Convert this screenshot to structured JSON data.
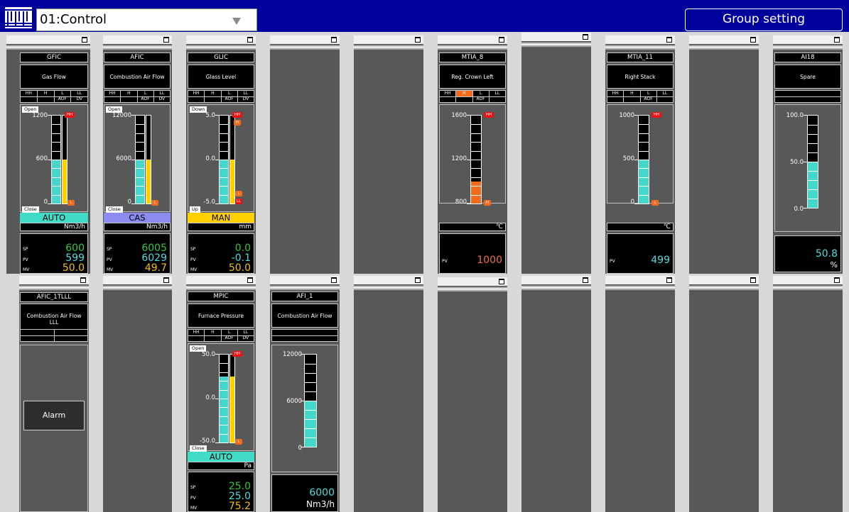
{
  "header": {
    "group_value": "01:Control",
    "group_setting_label": "Group setting"
  },
  "colors": {
    "header_bg": "#00009c",
    "pv_bar": "#44d8cc",
    "mv_bar": "#ffd000",
    "auto_mode": "#40dcc8",
    "cas_mode": "#8c8cf0",
    "man_mode": "#ffd000",
    "alarm_active": "#f26b1d",
    "hh_marker": "#e11111"
  },
  "alarm_labels": {
    "hh": "HH",
    "h": "H",
    "l": "L",
    "ll": "LL",
    "aof": "AOF",
    "dv": "DV"
  },
  "value_keys": {
    "sp": "SP",
    "pv": "PV",
    "mv": "MV"
  },
  "faceplates": {
    "gfic": {
      "tag": "GFIC",
      "comment": "Gas Flow",
      "scale_top": "1200",
      "scale_mid": "600",
      "scale_bottom": "0",
      "open_label": "Open",
      "close_label": "Close",
      "mode": "AUTO",
      "unit": "Nm3/h",
      "sp": "600",
      "pv": "599",
      "mv": "50.0",
      "pv_fraction": 0.5,
      "mv_fraction": 0.5
    },
    "afic": {
      "tag": "AFIC",
      "comment": "Combustion Air Flow",
      "scale_top": "12000",
      "scale_mid": "6000",
      "scale_bottom": "0",
      "open_label": "Open",
      "close_label": "Close",
      "mode": "CAS",
      "unit": "Nm3/h",
      "sp": "6005",
      "pv": "6029",
      "mv": "49.7",
      "pv_fraction": 0.5,
      "mv_fraction": 0.5
    },
    "glic": {
      "tag": "GLIC",
      "comment": "Glass Level",
      "scale_top": "5.0",
      "scale_mid": "0.0",
      "scale_bottom": "-5.0",
      "open_label": "Down",
      "close_label": "Up",
      "mode": "MAN",
      "unit": "mm",
      "sp": "0.0",
      "pv": "-0.1",
      "mv": "50.0",
      "pv_fraction": 0.5,
      "mv_fraction": 0.5
    },
    "mtia8": {
      "tag": "MTIA_8",
      "comment": "Reg. Crown Left",
      "scale_top": "1600",
      "scale_mid": "1200",
      "scale_bottom": "800",
      "unit": "℃",
      "pv": "1000",
      "pv_fraction": 0.25
    },
    "mtia11": {
      "tag": "MTIA_11",
      "comment": "Right Stack",
      "scale_top": "1000",
      "scale_mid": "500",
      "scale_bottom": "0",
      "unit": "℃",
      "pv": "499",
      "pv_fraction": 0.5
    },
    "ai18": {
      "tag": "AI18",
      "comment": "Spare",
      "scale_top": "100.0",
      "scale_mid": "50.0",
      "scale_bottom": "0.0",
      "pv": "50.8",
      "unit": "%",
      "pv_fraction": 0.5
    },
    "afic1tllll": {
      "tag": "AFIC_1TLLL",
      "comment_line1": "Combustion Air Flow",
      "comment_line2": "LLL",
      "alarm_button": "Alarm"
    },
    "mpic": {
      "tag": "MPIC",
      "comment": "Furnace Pressure",
      "scale_top": "50.0",
      "scale_mid": "0.0",
      "scale_bottom": "-50.0",
      "open_label": "Open",
      "close_label": "Close",
      "mode": "AUTO",
      "unit": "Pa",
      "sp": "25.0",
      "pv": "25.0",
      "mv": "75.2",
      "pv_fraction": 0.75,
      "mv_fraction": 0.75
    },
    "afi1": {
      "tag": "AFI_1",
      "comment": "Combustion Air Flow",
      "scale_top": "12000",
      "scale_mid": "6000",
      "scale_bottom": "0",
      "pv": "6000",
      "unit": "Nm3/h",
      "pv_fraction": 0.5
    }
  }
}
